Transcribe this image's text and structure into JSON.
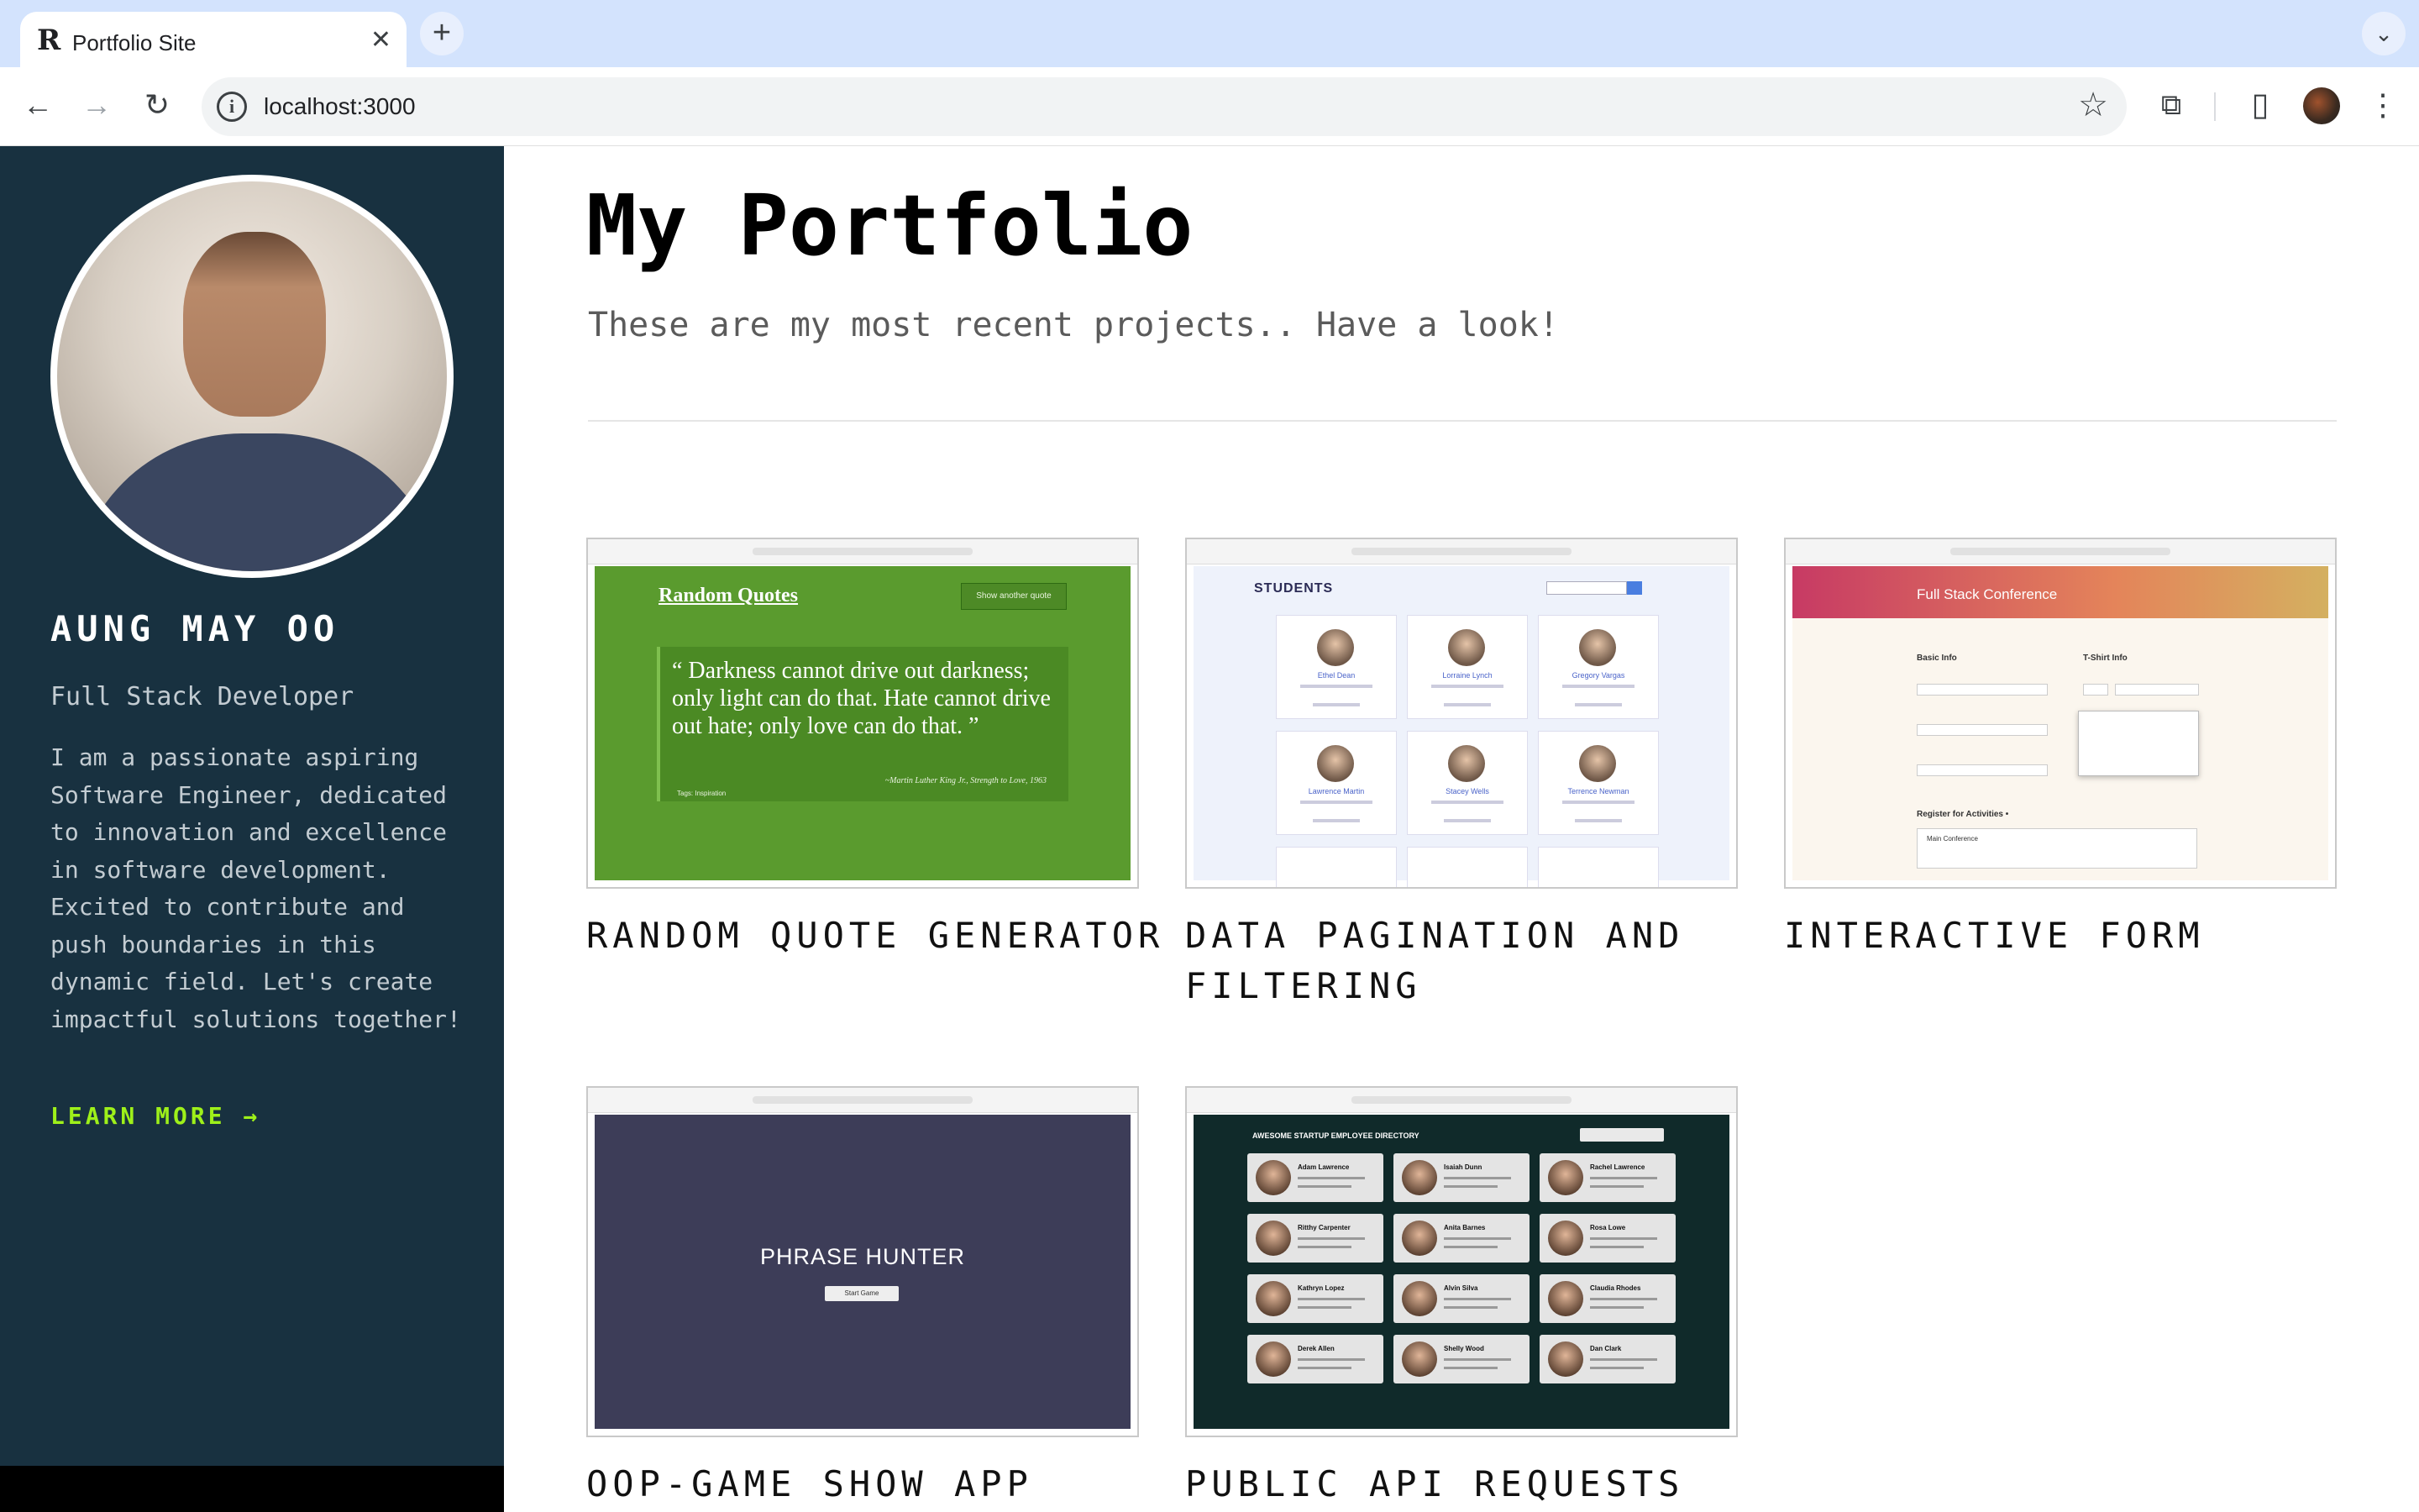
{
  "browser": {
    "tab_logo": "R",
    "tab_title": "Portfolio Site",
    "tab_close": "✕",
    "new_tab": "+",
    "tab_menu": "⌄",
    "url": "localhost:3000",
    "back": "←",
    "forward": "→",
    "reload": "↻",
    "star": "☆",
    "extensions": "⧉",
    "sidepanel": "▯",
    "menu": "⋮"
  },
  "sidebar": {
    "name": "AUNG MAY OO",
    "role": "Full Stack Developer",
    "bio": "I am a passionate aspiring Software Engineer, dedicated to innovation and excellence in software development. Excited to contribute and push boundaries in this dynamic field. Let's create impactful solutions together!",
    "learn_more": "LEARN MORE →"
  },
  "main": {
    "title": "My Portfolio",
    "subtitle": "These are my most recent projects.. Have a look!"
  },
  "projects": [
    {
      "title": "RANDOM QUOTE GENERATOR",
      "thumb": {
        "heading": "Random Quotes",
        "button": "Show another quote",
        "quote": "“ Darkness cannot drive out darkness; only light can do that. Hate cannot drive out hate; only love can do that. ”",
        "cite": "~Martin Luther King Jr., Strength to Love, 1963",
        "tag": "Tags: Inspiration"
      }
    },
    {
      "title": "DATA PAGINATION AND FILTERING",
      "thumb": {
        "heading": "STUDENTS",
        "students": [
          "Ethel Dean",
          "Lorraine Lynch",
          "Gregory Vargas",
          "Lawrence Martin",
          "Stacey Wells",
          "Terrence Newman"
        ]
      }
    },
    {
      "title": "INTERACTIVE FORM",
      "thumb": {
        "heading": "Full Stack Conference",
        "basic_info": "Basic Info",
        "tshirt_info": "T-Shirt Info",
        "register": "Register for Activities •",
        "main_conf": "Main Conference"
      }
    },
    {
      "title": "OOP-GAME SHOW APP",
      "thumb": {
        "heading": "PHRASE HUNTER",
        "button": "Start Game"
      }
    },
    {
      "title": "PUBLIC API REQUESTS",
      "thumb": {
        "heading": "AWESOME STARTUP EMPLOYEE DIRECTORY",
        "employees": [
          "Adam Lawrence",
          "Isaiah Dunn",
          "Rachel Lawrence",
          "Ritthy Carpenter",
          "Anita Barnes",
          "Rosa Lowe",
          "Kathryn Lopez",
          "Alvin Silva",
          "Claudia Rhodes",
          "Derek Allen",
          "Shelly Wood",
          "Dan Clark"
        ]
      }
    }
  ]
}
